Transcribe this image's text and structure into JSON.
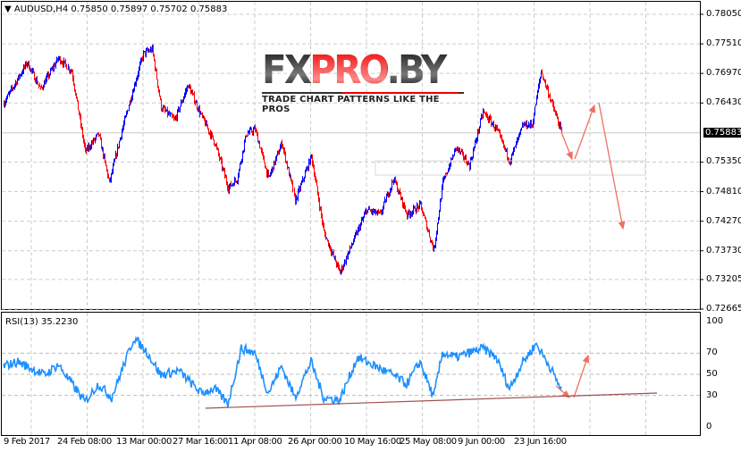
{
  "header": {
    "symbol_line": "AUDUSD,H4  0.75850 0.75897 0.75702 0.75883",
    "dropdown_icon": "triangle-down"
  },
  "price_axis": {
    "labels": [
      "0.78050",
      "0.77510",
      "0.76970",
      "0.76430",
      "0.75350",
      "0.74810",
      "0.74270",
      "0.73730",
      "0.73205",
      "0.72665"
    ],
    "current_price": "0.75883",
    "range": [
      0.72665,
      0.7805
    ]
  },
  "rsi": {
    "title": "RSI(13) 35.2230",
    "axis_labels": [
      "100",
      "70",
      "50",
      "30",
      "0"
    ],
    "color": "#1e90ff"
  },
  "time_axis": {
    "labels": [
      "9 Feb 2017",
      "24 Feb 08:00",
      "13 Mar 00:00",
      "27 Mar 16:00",
      "11 Apr 08:00",
      "26 Apr 00:00",
      "10 May 16:00",
      "25 May 08:00",
      "9 Jun 00:00",
      "23 Jun 16:00"
    ]
  },
  "logo": {
    "text_main": "FXPRO.BY",
    "tagline": "TRADE CHART PATTERNS LIKE THE PROS"
  },
  "colors": {
    "up": "#0000ff",
    "down": "#ff0000",
    "arrow": "#f07060",
    "trendline": "#a05050"
  },
  "chart_data": {
    "type": "line",
    "price_series": {
      "name": "AUDUSD H4 close (approx, by bar index)",
      "points": [
        [
          0,
          0.7643
        ],
        [
          26,
          0.7717
        ],
        [
          41,
          0.7668
        ],
        [
          61,
          0.7725
        ],
        [
          76,
          0.7701
        ],
        [
          91,
          0.7554
        ],
        [
          106,
          0.7586
        ],
        [
          118,
          0.7497
        ],
        [
          131,
          0.7586
        ],
        [
          146,
          0.7676
        ],
        [
          156,
          0.7733
        ],
        [
          166,
          0.7741
        ],
        [
          176,
          0.7635
        ],
        [
          191,
          0.7611
        ],
        [
          206,
          0.7676
        ],
        [
          221,
          0.7619
        ],
        [
          236,
          0.757
        ],
        [
          251,
          0.7488
        ],
        [
          261,
          0.7505
        ],
        [
          271,
          0.7586
        ],
        [
          281,
          0.7595
        ],
        [
          296,
          0.7505
        ],
        [
          311,
          0.757
        ],
        [
          326,
          0.7464
        ],
        [
          344,
          0.7546
        ],
        [
          358,
          0.7407
        ],
        [
          376,
          0.7333
        ],
        [
          391,
          0.7391
        ],
        [
          406,
          0.7448
        ],
        [
          421,
          0.7439
        ],
        [
          436,
          0.7505
        ],
        [
          451,
          0.7439
        ],
        [
          466,
          0.7456
        ],
        [
          481,
          0.7374
        ],
        [
          491,
          0.7497
        ],
        [
          506,
          0.7562
        ],
        [
          521,
          0.7529
        ],
        [
          536,
          0.7627
        ],
        [
          551,
          0.7595
        ],
        [
          566,
          0.7537
        ],
        [
          581,
          0.7603
        ],
        [
          591,
          0.7603
        ],
        [
          601,
          0.7701
        ],
        [
          611,
          0.7652
        ],
        [
          624,
          0.7588
        ]
      ]
    },
    "rsi_series": {
      "name": "RSI(13)",
      "points": [
        [
          0,
          57.6
        ],
        [
          16,
          61.9
        ],
        [
          46,
          49.2
        ],
        [
          61,
          59.3
        ],
        [
          91,
          23.7
        ],
        [
          106,
          40.7
        ],
        [
          121,
          28
        ],
        [
          146,
          84.7
        ],
        [
          161,
          70.3
        ],
        [
          176,
          49.2
        ],
        [
          196,
          53.4
        ],
        [
          221,
          32.2
        ],
        [
          236,
          36.4
        ],
        [
          251,
          22
        ],
        [
          266,
          74.6
        ],
        [
          281,
          70.3
        ],
        [
          296,
          32.2
        ],
        [
          311,
          57.6
        ],
        [
          326,
          28
        ],
        [
          344,
          61.9
        ],
        [
          358,
          28
        ],
        [
          376,
          25.4
        ],
        [
          396,
          66.1
        ],
        [
          416,
          57.6
        ],
        [
          436,
          49.2
        ],
        [
          451,
          40.7
        ],
        [
          466,
          61.9
        ],
        [
          481,
          28
        ],
        [
          491,
          70.3
        ],
        [
          506,
          66.1
        ],
        [
          521,
          70.3
        ],
        [
          536,
          74.6
        ],
        [
          551,
          66.1
        ],
        [
          566,
          36.4
        ],
        [
          581,
          61.9
        ],
        [
          596,
          78.8
        ],
        [
          611,
          57.6
        ],
        [
          624,
          35.2
        ]
      ]
    },
    "rsi_levels": [
      70,
      50,
      30
    ],
    "rsi_range": [
      0,
      100
    ]
  }
}
